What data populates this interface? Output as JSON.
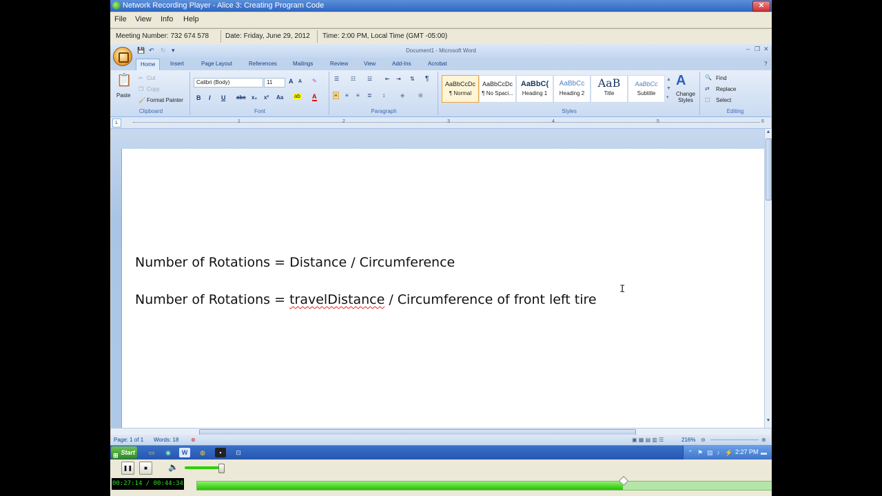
{
  "player": {
    "title": "Network Recording Player - Alice 3: Creating Program Code",
    "close_glyph": "✕",
    "menu": [
      "File",
      "View",
      "Info",
      "Help"
    ],
    "info": {
      "meeting": "Meeting Number: 732 674 578",
      "date": "Date: Friday, June 29, 2012",
      "time": "Time: 2:00 PM, Local Time (GMT -05:00)"
    },
    "controls": {
      "pause_glyph": "❚❚",
      "stop_glyph": "■",
      "volume_glyph": "🔈",
      "volume_level": 0.95,
      "time_display": "00:27:14 / 00:44:34",
      "progress_fraction": 0.74
    }
  },
  "word": {
    "title": "Document1 - Microsoft Word",
    "window_controls": [
      "–",
      "❐",
      "✕"
    ],
    "tabs": [
      "Home",
      "Insert",
      "Page Layout",
      "References",
      "Mailings",
      "Review",
      "View",
      "Add-Ins",
      "Acrobat"
    ],
    "active_tab": "Home",
    "ribbon": {
      "clipboard": {
        "paste": "Paste",
        "cut": "Cut",
        "copy": "Copy",
        "format_painter": "Format Painter",
        "label": "Clipboard"
      },
      "font": {
        "name": "Calibri (Body)",
        "size": "11",
        "bold": "B",
        "italic": "I",
        "underline": "U",
        "strike": "abe",
        "subscript": "x₂",
        "superscript": "x²",
        "case": "Aa",
        "grow": "A",
        "shrink": "A",
        "label": "Font"
      },
      "paragraph": {
        "label": "Paragraph",
        "pilcrow": "¶"
      },
      "styles": {
        "label": "Styles",
        "items": [
          {
            "preview": "AaBbCcDc",
            "name": "¶ Normal"
          },
          {
            "preview": "AaBbCcDc",
            "name": "¶ No Spaci..."
          },
          {
            "preview": "AaBbC(",
            "name": "Heading 1"
          },
          {
            "preview": "AaBbCc",
            "name": "Heading 2"
          },
          {
            "preview": "AaB",
            "name": "Title"
          },
          {
            "preview": "AaBbCc",
            "name": "Subtitle"
          }
        ],
        "selected_index": 0,
        "change_styles": "Change Styles"
      },
      "editing": {
        "find": "Find",
        "replace": "Replace",
        "select": "Select",
        "label": "Editing"
      }
    },
    "ruler_numbers": [
      "1",
      "2",
      "3",
      "4",
      "5",
      "6"
    ],
    "document": {
      "line1": "Number of Rotations = Distance / Circumference",
      "line2_before": "Number of Rotations = ",
      "line2_misspelled": "travelDistance",
      "line2_after": " / Circumference of front left tire"
    },
    "status": {
      "page": "Page: 1 of 1",
      "words": "Words: 18",
      "zoom": "216%"
    }
  },
  "taskbar": {
    "start_label": "Start",
    "clock": "2:27 PM"
  },
  "colors": {
    "spell_error": "#e02020",
    "progress_green": "#26c000",
    "ribbon_text": "#15428b"
  }
}
